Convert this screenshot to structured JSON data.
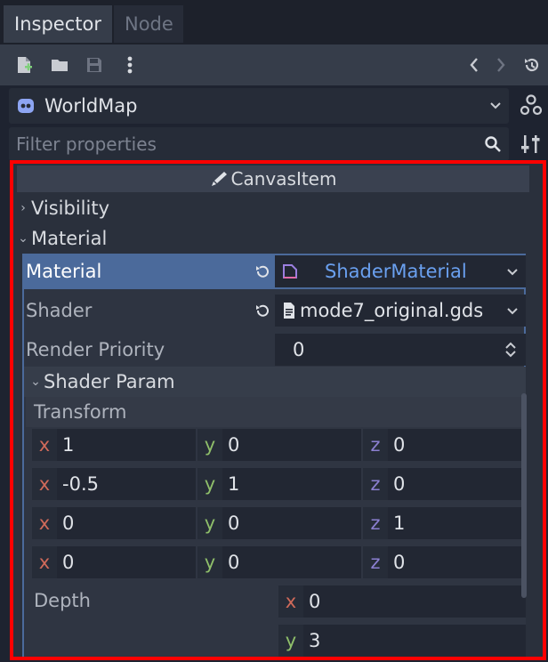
{
  "tabs": [
    {
      "label": "Inspector",
      "active": true
    },
    {
      "label": "Node",
      "active": false
    }
  ],
  "object": {
    "name": "WorldMap"
  },
  "filter": {
    "placeholder": "Filter properties"
  },
  "category": {
    "title": "CanvasItem"
  },
  "sections": {
    "visibility": "Visibility",
    "material": "Material"
  },
  "material_prop": {
    "label": "Material",
    "value": "ShaderMaterial"
  },
  "shader_prop": {
    "label": "Shader",
    "value": "mode7_original.gds"
  },
  "render_priority": {
    "label": "Render Priority",
    "value": "0"
  },
  "shader_param": {
    "title": "Shader Param"
  },
  "transform": {
    "label": "Transform",
    "rows": [
      {
        "x": "1",
        "y": "0",
        "z": "0"
      },
      {
        "x": "-0.5",
        "y": "1",
        "z": "0"
      },
      {
        "x": "0",
        "y": "0",
        "z": "1"
      },
      {
        "x": "0",
        "y": "0",
        "z": "0"
      }
    ]
  },
  "depth": {
    "label": "Depth",
    "x": "0",
    "y": "3"
  },
  "axis_labels": {
    "x": "x",
    "y": "y",
    "z": "z"
  },
  "colors": {
    "accent": "#4b6a9b",
    "link_blue": "#6aa0f0",
    "axis_x": "#d06a5a",
    "axis_y": "#8fbf6a",
    "axis_z": "#8b7fd0",
    "highlight": "#ff0000"
  }
}
